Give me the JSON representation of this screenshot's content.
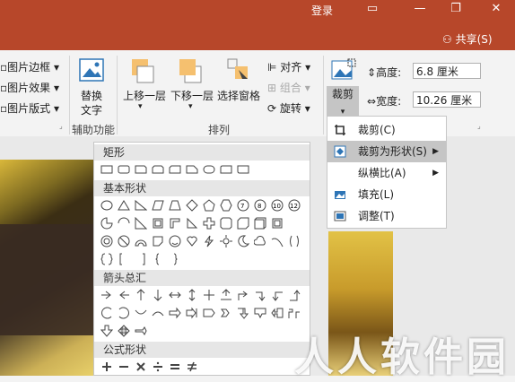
{
  "titlebar": {
    "login": "登录",
    "share": "共享(S)",
    "window_icons": [
      "ribbon-display-icon",
      "minimize-icon",
      "restore-icon",
      "close-icon"
    ]
  },
  "ribbon": {
    "picture_border": "图片边框",
    "picture_effects": "图片效果",
    "picture_layout": "图片版式",
    "alt_text_line1": "替换",
    "alt_text_line2": "文字",
    "group_accessibility": "辅助功能",
    "bring_forward": "上移一层",
    "send_backward": "下移一层",
    "selection_pane": "选择窗格",
    "align": "对齐",
    "group": "组合",
    "rotate": "旋转",
    "group_arrange": "排列",
    "crop": "裁剪",
    "height_label": "高度:",
    "height_value": "6.8 厘米",
    "width_label": "宽度:",
    "width_value": "10.26 厘米"
  },
  "shapes_gallery": {
    "categories": [
      "矩形",
      "基本形状",
      "箭头总汇",
      "公式形状"
    ]
  },
  "crop_menu": {
    "items": [
      {
        "label": "裁剪(C)",
        "icon": "crop-icon"
      },
      {
        "label": "裁剪为形状(S)",
        "icon": "crop-to-shape-icon"
      },
      {
        "label": "纵横比(A)",
        "icon": ""
      },
      {
        "label": "填充(L)",
        "icon": "fill-icon"
      },
      {
        "label": "调整(T)",
        "icon": "fit-icon"
      }
    ]
  },
  "watermark": "人人软件园",
  "colors": {
    "accent": "#b7472a",
    "menu_active": "#c5c5c5"
  }
}
